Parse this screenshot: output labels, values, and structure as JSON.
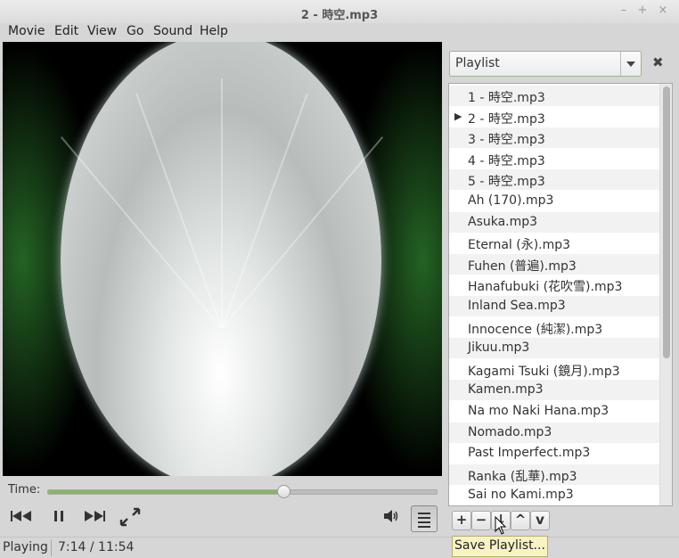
{
  "window": {
    "title": "2 - 時空.mp3",
    "controls": [
      "–",
      "+",
      "×"
    ]
  },
  "menu": [
    "Movie",
    "Edit",
    "View",
    "Go",
    "Sound",
    "Help"
  ],
  "time_label": "Time:",
  "seek": {
    "progress": 0.605
  },
  "status": {
    "state": "Playing",
    "time": "7:14 / 11:54"
  },
  "sidebar": {
    "selector": "Playlist"
  },
  "playlist": {
    "current_index": 1,
    "items": [
      "1 - 時空.mp3",
      "2 - 時空.mp3",
      "3 - 時空.mp3",
      "4 - 時空.mp3",
      "5 - 時空.mp3",
      "Ah (170).mp3",
      "Asuka.mp3",
      "Eternal (永).mp3",
      "Fuhen (普遍).mp3",
      "Hanafubuki (花吹雪).mp3",
      "Inland Sea.mp3",
      "Innocence (純潔).mp3",
      "Jikuu.mp3",
      "Kagami Tsuki (鏡月).mp3",
      "Kamen.mp3",
      "Na mo Naki Hana.mp3",
      "Nomado.mp3",
      "Past Imperfect.mp3",
      "Ranka (乱華).mp3",
      "Sai no Kami.mp3"
    ],
    "tools": [
      "+",
      "−",
      "↓",
      "^",
      "v"
    ],
    "tooltip": "Save Playlist..."
  },
  "colors": {
    "seek_fill": "#87b56b",
    "tooltip_bg": "#f8f3c3"
  }
}
